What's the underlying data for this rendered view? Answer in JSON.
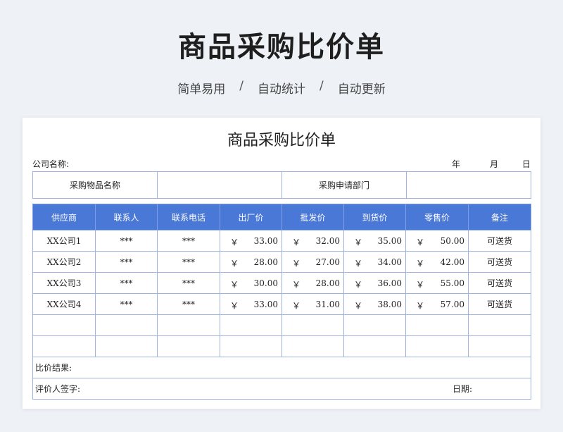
{
  "hero": {
    "title": "商品采购比价单",
    "subtitle": [
      "简单易用",
      "自动统计",
      "自动更新"
    ],
    "separator": "/"
  },
  "sheet": {
    "title": "商品采购比价单",
    "company_label": "公司名称:",
    "year_label": "年",
    "month_label": "月",
    "day_label": "日",
    "item_name_label": "采购物品名称",
    "item_name_value": "",
    "dept_label": "采购申请部门",
    "dept_value": ""
  },
  "table": {
    "headers": [
      "供应商",
      "联系人",
      "联系电话",
      "出厂价",
      "批发价",
      "到货价",
      "零售价",
      "备注"
    ],
    "currency": "￥",
    "rows": [
      {
        "supplier": "XX公司1",
        "contact": "***",
        "phone": "***",
        "factory": "33.00",
        "wholesale": "32.00",
        "delivered": "35.00",
        "retail": "50.00",
        "note": "可送货"
      },
      {
        "supplier": "XX公司2",
        "contact": "***",
        "phone": "***",
        "factory": "28.00",
        "wholesale": "27.00",
        "delivered": "34.00",
        "retail": "42.00",
        "note": "可送货"
      },
      {
        "supplier": "XX公司3",
        "contact": "***",
        "phone": "***",
        "factory": "30.00",
        "wholesale": "28.00",
        "delivered": "36.00",
        "retail": "55.00",
        "note": "可送货"
      },
      {
        "supplier": "XX公司4",
        "contact": "***",
        "phone": "***",
        "factory": "33.00",
        "wholesale": "31.00",
        "delivered": "38.00",
        "retail": "57.00",
        "note": "可送货"
      }
    ],
    "empty_rows": 2
  },
  "footer": {
    "result_label": "比价结果:",
    "evaluator_label": "评价人签字:",
    "date_label": "日期:"
  },
  "colors": {
    "header_bg": "#4a78d6",
    "border": "#9fb3e0",
    "page_bg": "#eef1f6"
  }
}
